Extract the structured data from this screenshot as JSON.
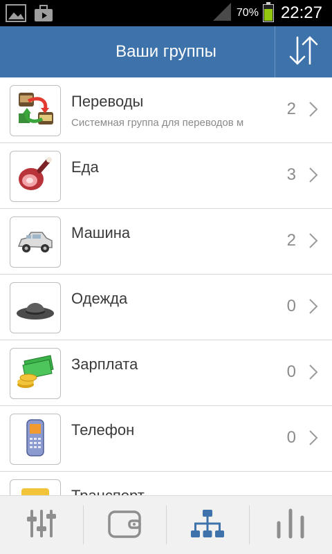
{
  "status": {
    "battery_percent": "70%",
    "battery_level": 0.7,
    "time": "22:27",
    "icons": [
      "image-icon",
      "briefcase-icon",
      "signal-icon",
      "battery-icon"
    ]
  },
  "header": {
    "title": "Ваши группы",
    "sort_icon": "sort-arrows-icon"
  },
  "groups": [
    {
      "name": "Переводы",
      "description": "Системная группа для переводов м",
      "count": "2",
      "icon": "transfer-icon"
    },
    {
      "name": "Еда",
      "description": "",
      "count": "3",
      "icon": "ham-icon"
    },
    {
      "name": "Машина",
      "description": "",
      "count": "2",
      "icon": "car-icon"
    },
    {
      "name": "Одежда",
      "description": "",
      "count": "0",
      "icon": "hat-icon"
    },
    {
      "name": "Зарплата",
      "description": "",
      "count": "0",
      "icon": "money-icon"
    },
    {
      "name": "Телефон",
      "description": "",
      "count": "0",
      "icon": "phone-icon"
    },
    {
      "name": "Транспорт",
      "description": "",
      "count": "",
      "icon": "transport-icon"
    }
  ],
  "tabs": [
    {
      "icon": "sliders-icon",
      "active": false
    },
    {
      "icon": "wallet-icon",
      "active": false
    },
    {
      "icon": "hierarchy-icon",
      "active": true
    },
    {
      "icon": "bar-chart-icon",
      "active": false
    }
  ],
  "colors": {
    "header": "#3d73aa",
    "active_tab": "#3d73aa",
    "inactive_tab": "#8e8e8e"
  }
}
